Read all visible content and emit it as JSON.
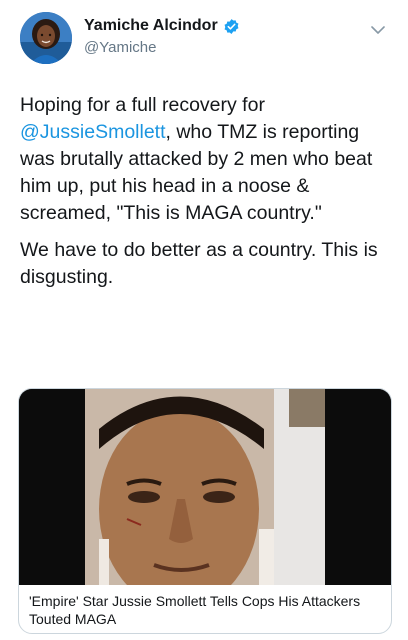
{
  "author": {
    "display_name": "Yamiche Alcindor",
    "handle": "@Yamiche",
    "verified_icon": "verified-badge-icon"
  },
  "tweet": {
    "line1_pre": "Hoping for a full recovery for",
    "mention": "@JussieSmollett",
    "line1_post": ", who TMZ is reporting was brutally attacked by 2 men who beat him up, put his head in a noose & screamed, \"This is MAGA country.\"",
    "paragraph2": "We have to do better as a country. This is disgusting."
  },
  "card": {
    "title": "'Empire' Star Jussie Smollett Tells Cops His Attackers Touted MAGA",
    "media": "photo-of-injured-face"
  },
  "colors": {
    "link": "#1b95e0",
    "verified": "#1da1f2",
    "secondary_text": "#657786",
    "border": "#ccd6dd"
  }
}
